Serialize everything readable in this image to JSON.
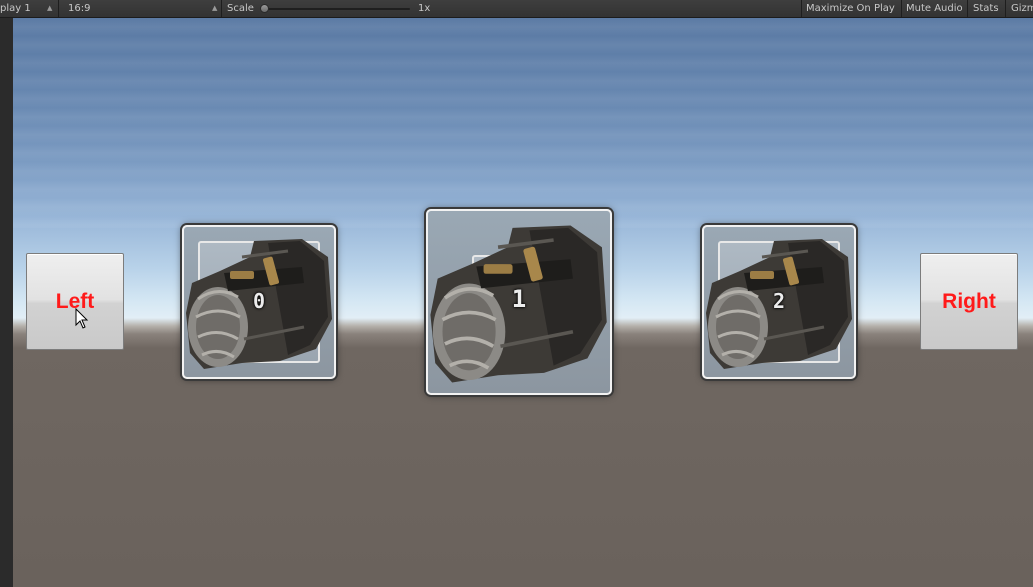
{
  "toolbar": {
    "display": "play 1",
    "aspect": "16:9",
    "scale_label": "Scale",
    "scale_value": "1x",
    "maximize": "Maximize On Play",
    "mute": "Mute Audio",
    "stats": "Stats",
    "gizmos": "Gizm"
  },
  "buttons": {
    "left": "Left",
    "right": "Right"
  },
  "slots": [
    {
      "number": "0",
      "selected": false
    },
    {
      "number": "1",
      "selected": true
    },
    {
      "number": "2",
      "selected": false
    }
  ],
  "icons": {
    "item": "boot-icon",
    "cursor": "mouse-pointer-icon"
  },
  "colors": {
    "button_text": "#ff1a1a",
    "slot_border": "#f2f2f2",
    "toolbar_bg": "#3a3a3a"
  }
}
